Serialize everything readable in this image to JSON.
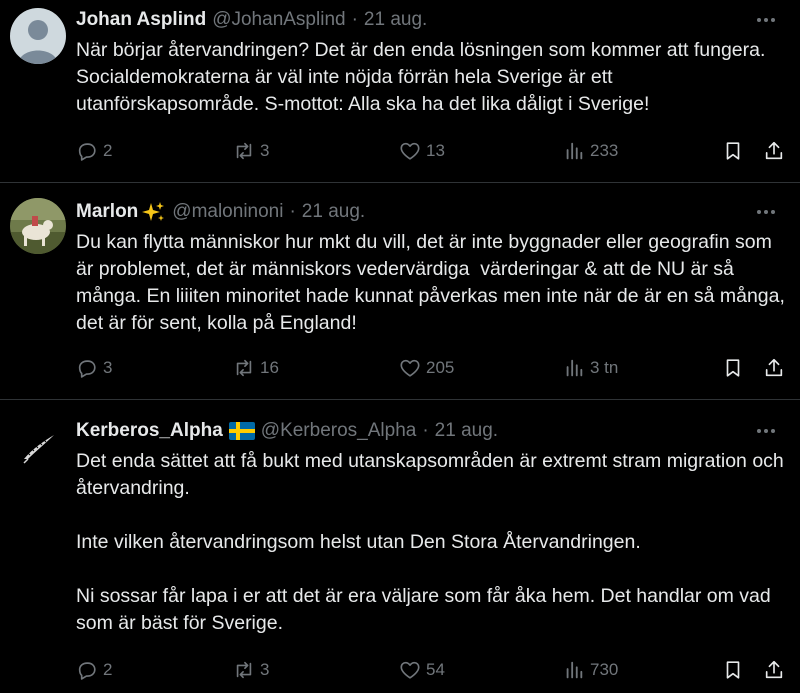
{
  "tweets": [
    {
      "name": "Johan Asplind",
      "handle": "@JohanAsplind",
      "separator": "·",
      "date": "21 aug.",
      "lines": [
        "När börjar återvandringen? Det är den enda lösningen som kommer att fungera. Socialdemokraterna är väl inte nöjda förrän hela Sverige är ett utanförskapsområde. S-mottot: Alla ska ha det lika dåligt i Sverige!"
      ],
      "replies": "2",
      "retweets": "3",
      "likes": "13",
      "views": "233"
    },
    {
      "name": "Marlon",
      "name_emoji": "sparkles-icon",
      "handle": "@maloninoni",
      "separator": "·",
      "date": "21 aug.",
      "lines": [
        "Du kan flytta människor hur mkt du vill, det är inte byggnader eller geografin som är problemet, det är människors vedervärdiga  värderingar & att de NU är så många. En liiiten minoritet hade kunnat påverkas men inte när de är en så många, det är för sent, kolla på England!"
      ],
      "replies": "3",
      "retweets": "16",
      "likes": "205",
      "views": "3 tn"
    },
    {
      "name": "Kerberos_Alpha",
      "name_emoji": "flag-sweden-icon",
      "handle": "@Kerberos_Alpha",
      "separator": "·",
      "date": "21 aug.",
      "lines": [
        "Det enda sättet att få bukt med utanskapsområden är extremt stram migration och återvandring.",
        "Inte vilken återvandringsom helst utan Den Stora Återvandringen.",
        "Ni sossar får lapa i er att det är era väljare som får åka hem. Det handlar om vad som är bäst för Sverige."
      ],
      "replies": "2",
      "retweets": "3",
      "likes": "54",
      "views": "730"
    }
  ],
  "icons": {
    "reply": "reply-icon",
    "retweet": "retweet-icon",
    "like": "heart-icon",
    "views": "views-chart-icon",
    "bookmark": "bookmark-icon",
    "share": "share-icon",
    "more": "more-dots-icon"
  },
  "colors": {
    "background": "#000000",
    "text": "#e7e9ea",
    "muted": "#71767b",
    "divider": "#2f3336"
  }
}
